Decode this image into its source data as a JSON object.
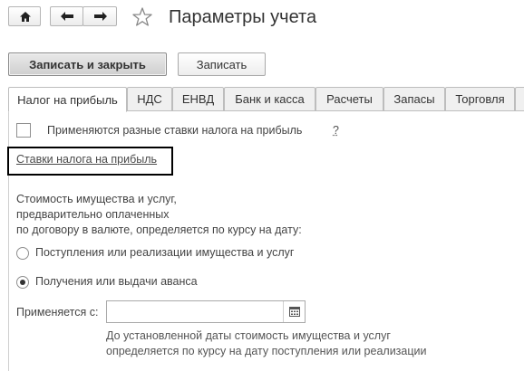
{
  "window": {
    "title": "Параметры учета"
  },
  "toolbar": {
    "save_close_label": "Записать и закрыть",
    "save_label": "Записать"
  },
  "tabs": [
    {
      "label": "Налог на прибыль",
      "active": true
    },
    {
      "label": "НДС",
      "active": false
    },
    {
      "label": "ЕНВД",
      "active": false
    },
    {
      "label": "Банк и касса",
      "active": false
    },
    {
      "label": "Расчеты",
      "active": false
    },
    {
      "label": "Запасы",
      "active": false
    },
    {
      "label": "Торговля",
      "active": false
    }
  ],
  "profit_tax": {
    "different_rates_label": "Применяются разные ставки налога на прибыль",
    "different_rates_checked": false,
    "help_label": "?",
    "rates_link": "Ставки налога на прибыль"
  },
  "valuation": {
    "description_lines": [
      "Стоимость имущества и услуг,",
      "предварительно оплаченных",
      "по договору в валюте, определяется по курсу на дату:"
    ],
    "options": [
      {
        "label": "Поступления или реализации имущества и услуг",
        "selected": false
      },
      {
        "label": "Получения или выдачи аванса",
        "selected": true
      }
    ],
    "applies_from_label": "Применяется с:",
    "applies_from_value": "",
    "hint_lines": [
      "До установленной даты стоимость имущества и услуг",
      "определяется по курсу на дату поступления или реализации"
    ]
  },
  "colors": {
    "link_box_border": "#000000",
    "tab_border": "#bdbdbd"
  }
}
